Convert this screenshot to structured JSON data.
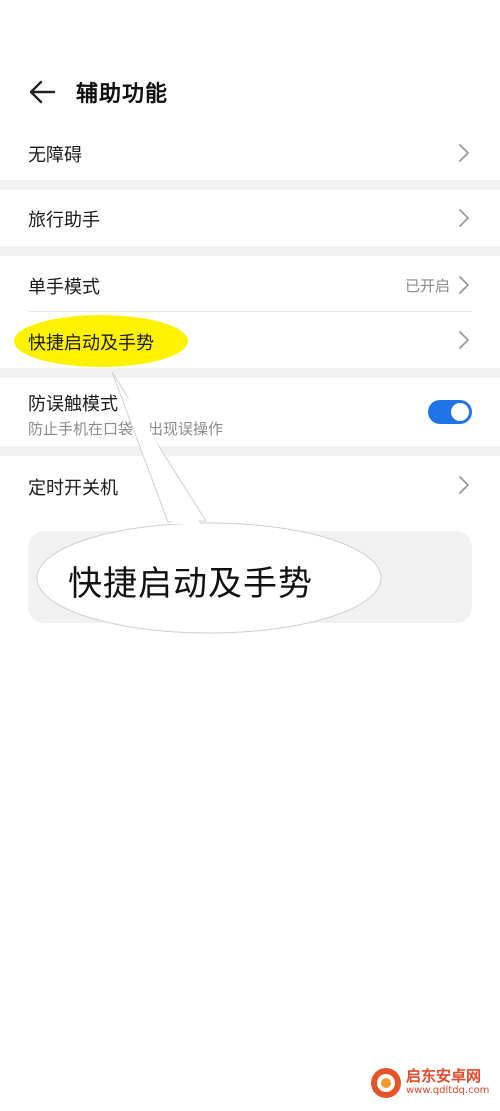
{
  "header": {
    "title": "辅助功能",
    "back_icon": "arrow-left-icon"
  },
  "items": {
    "accessibility": {
      "label": "无障碍"
    },
    "travel": {
      "label": "旅行助手"
    },
    "one_hand": {
      "label": "单手模式",
      "value": "已开启"
    },
    "shortcuts": {
      "label": "快捷启动及手势"
    },
    "anti_touch": {
      "label": "防误触模式",
      "subtitle": "防止手机在口袋中出现误操作",
      "enabled": true
    },
    "timer_power": {
      "label": "定时开关机"
    }
  },
  "annotation": {
    "bubble_text": "快捷启动及手势",
    "highlight_color": "#fff200"
  },
  "watermark": {
    "title": "启东安卓网",
    "url": "www.qdltdq.com"
  },
  "colors": {
    "accent": "#1f74e8",
    "separator": "#f1f1f1"
  }
}
